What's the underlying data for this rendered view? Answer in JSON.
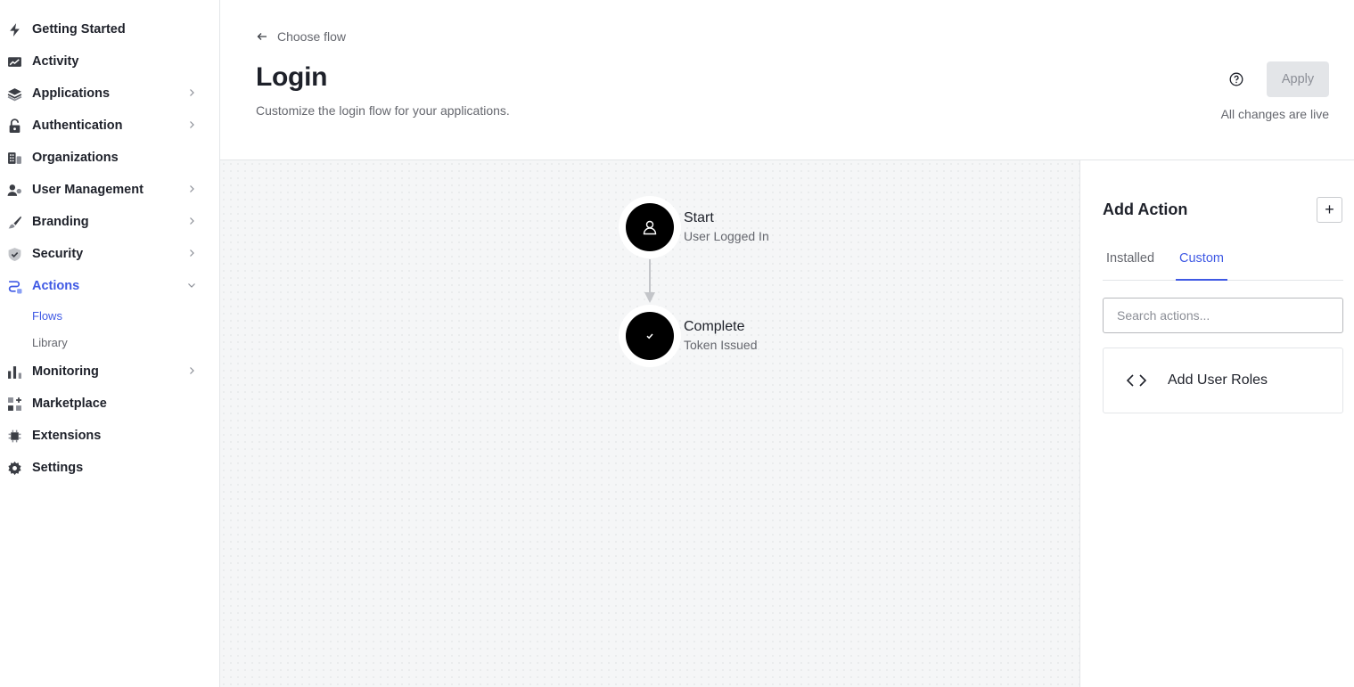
{
  "sidebar": {
    "items": [
      {
        "label": "Getting Started",
        "icon": "lightning-icon",
        "has_chevron": false
      },
      {
        "label": "Activity",
        "icon": "trend-chart-icon",
        "has_chevron": false
      },
      {
        "label": "Applications",
        "icon": "layers-icon",
        "has_chevron": true
      },
      {
        "label": "Authentication",
        "icon": "lock-icon",
        "has_chevron": true
      },
      {
        "label": "Organizations",
        "icon": "building-icon",
        "has_chevron": false
      },
      {
        "label": "User Management",
        "icon": "users-icon",
        "has_chevron": true
      },
      {
        "label": "Branding",
        "icon": "brush-icon",
        "has_chevron": true
      },
      {
        "label": "Security",
        "icon": "shield-icon",
        "has_chevron": true
      },
      {
        "label": "Actions",
        "icon": "actions-icon",
        "has_chevron": true,
        "expanded": true,
        "active": true
      },
      {
        "label": "Monitoring",
        "icon": "bar-chart-icon",
        "has_chevron": true
      },
      {
        "label": "Marketplace",
        "icon": "grid-plus-icon",
        "has_chevron": false
      },
      {
        "label": "Extensions",
        "icon": "chip-icon",
        "has_chevron": false
      },
      {
        "label": "Settings",
        "icon": "gear-icon",
        "has_chevron": false
      }
    ],
    "actions_subitems": [
      {
        "label": "Flows",
        "active": true
      },
      {
        "label": "Library",
        "active": false
      }
    ]
  },
  "header": {
    "back_label": "Choose flow",
    "title": "Login",
    "subtitle": "Customize the login flow for your applications.",
    "apply_label": "Apply",
    "status": "All changes are live"
  },
  "flow": {
    "nodes": [
      {
        "title": "Start",
        "subtitle": "User Logged In",
        "icon": "user-icon"
      },
      {
        "title": "Complete",
        "subtitle": "Token Issued",
        "icon": "check-icon"
      }
    ]
  },
  "panel": {
    "title": "Add Action",
    "add_button": "+",
    "tabs": [
      "Installed",
      "Custom"
    ],
    "active_tab": "Custom",
    "search_placeholder": "Search actions...",
    "actions": [
      {
        "label": "Add User Roles",
        "icon": "code-icon"
      }
    ]
  },
  "colors": {
    "accent": "#3f59e4",
    "text": "#1e212a",
    "muted": "#65676e",
    "canvas": "#f5f6f7"
  }
}
